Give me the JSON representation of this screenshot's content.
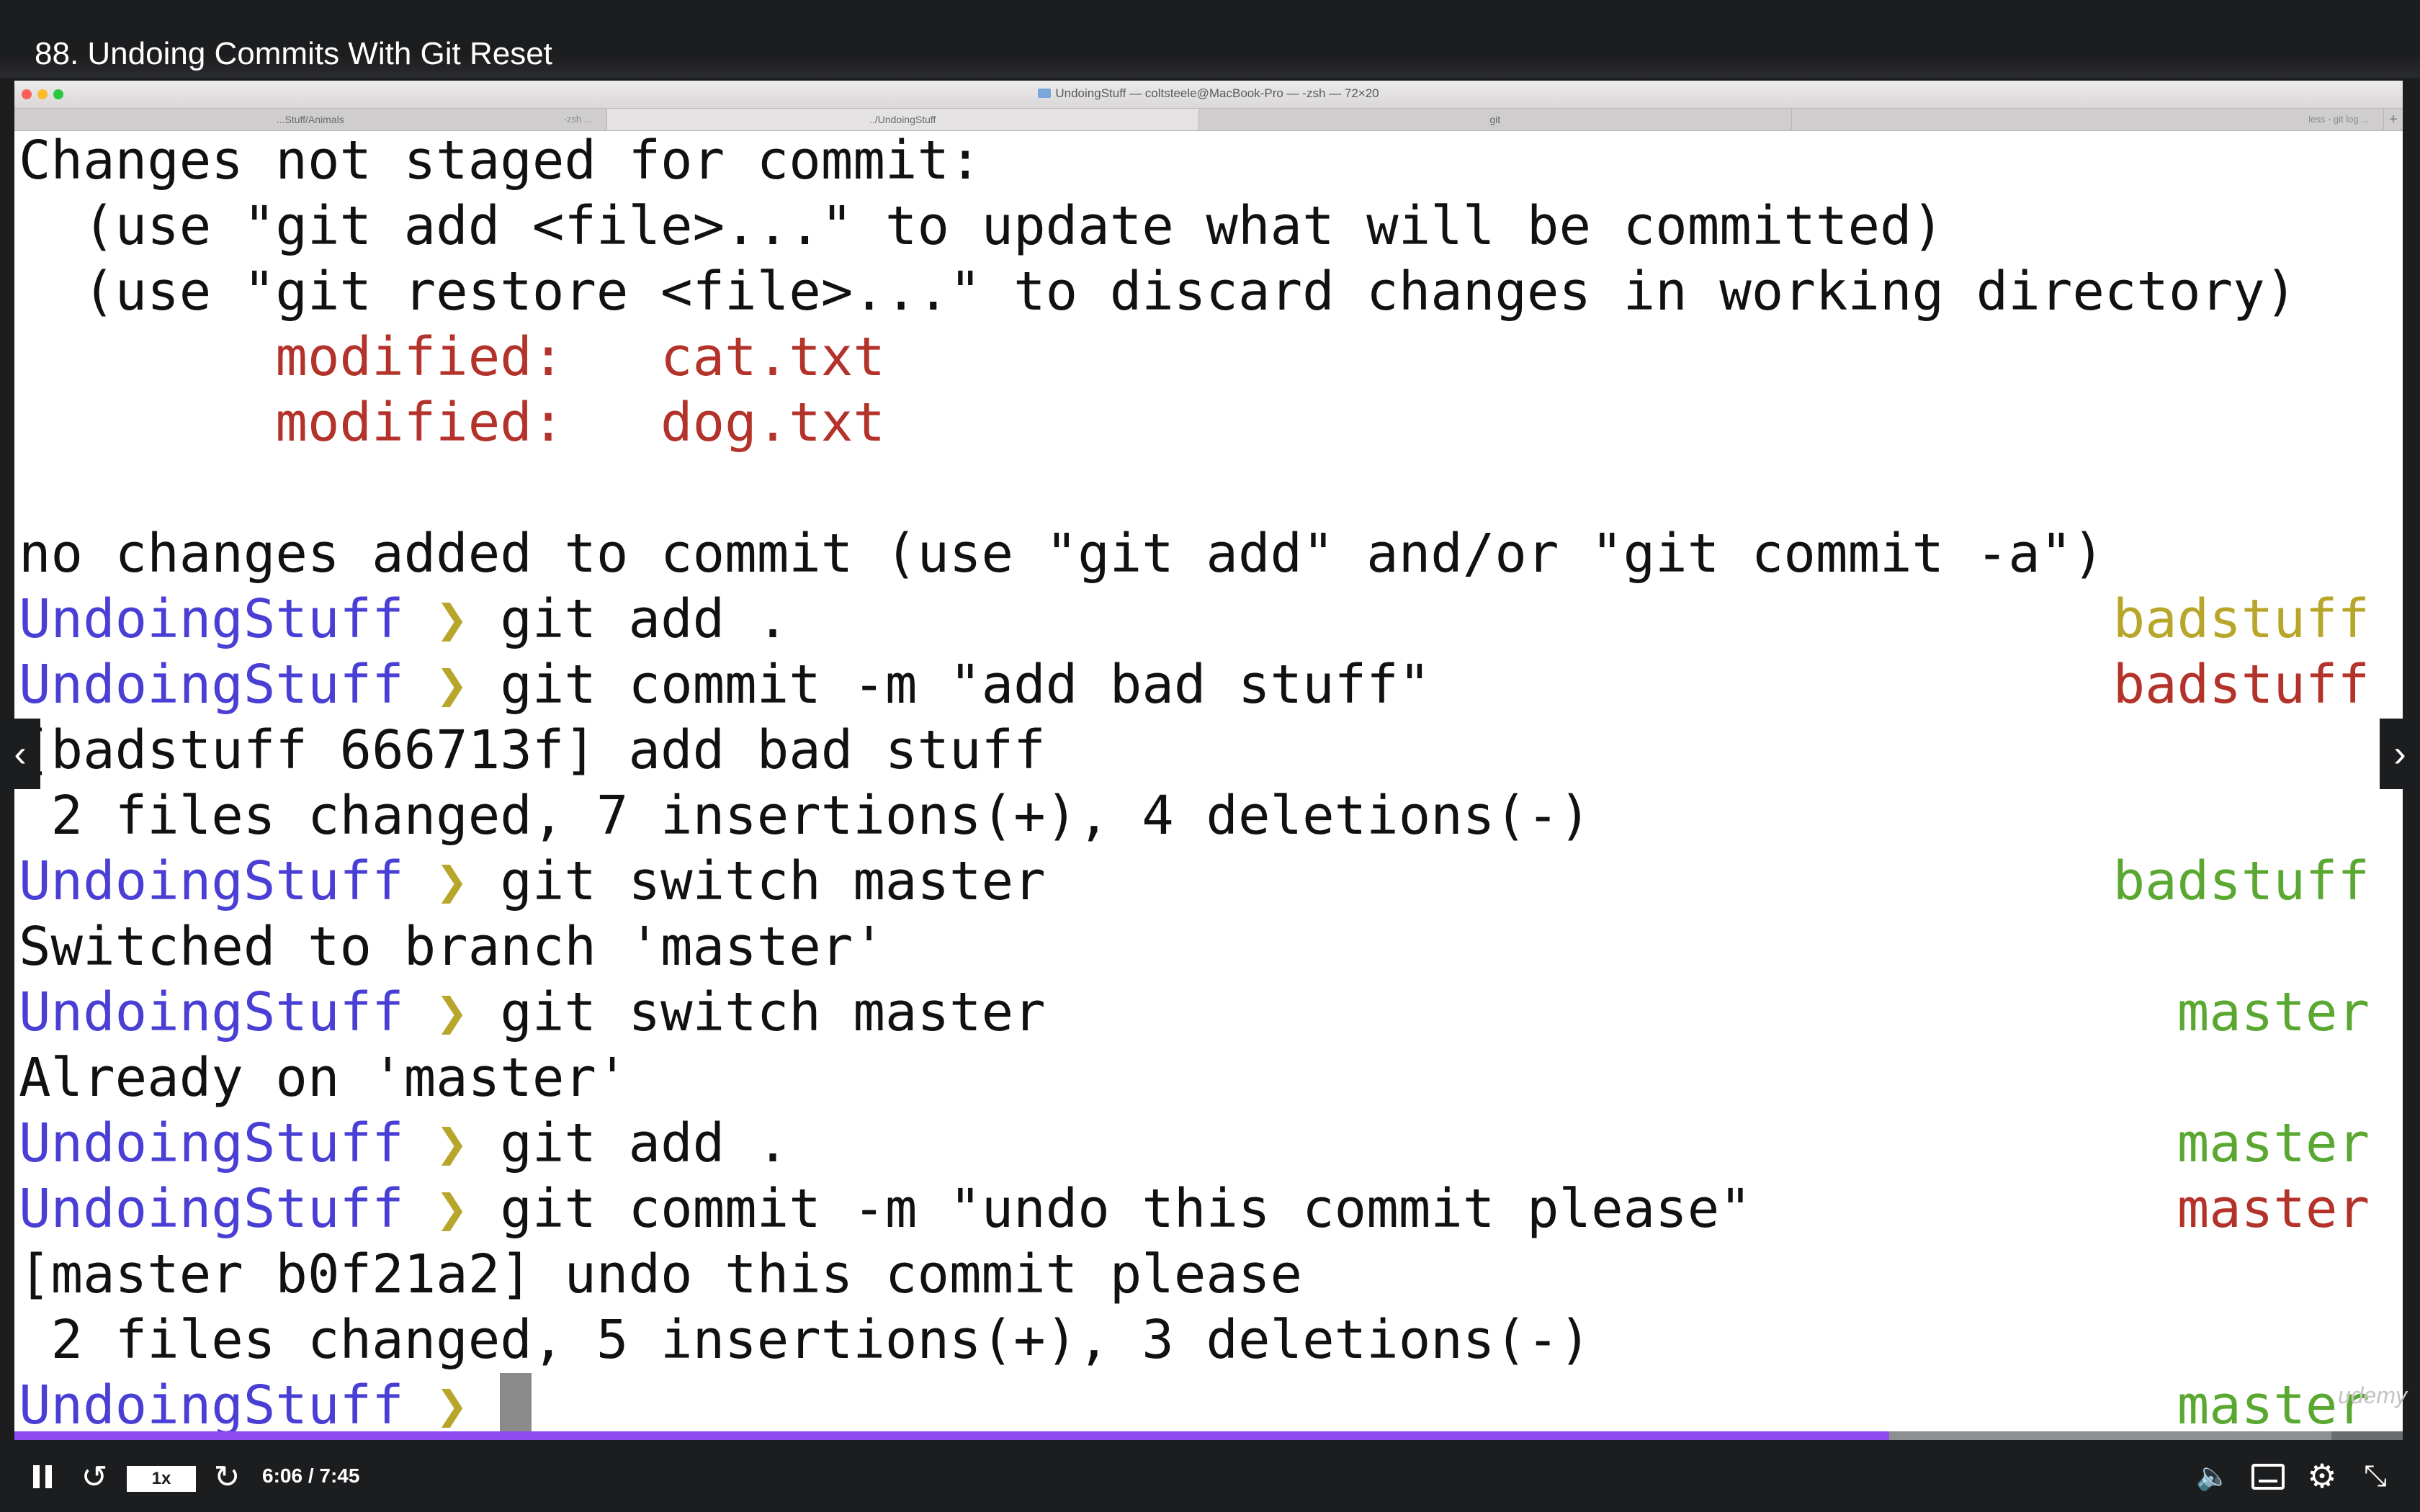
{
  "player": {
    "lecture_title": "88. Undoing Commits With Git Reset",
    "speed": "1x",
    "time": "6:06 / 7:45",
    "progress_fraction": 0.785,
    "buffered_fraction": 0.97,
    "watermark": "udemy"
  },
  "terminal_window": {
    "title": "UndoingStuff — coltsteele@MacBook-Pro — -zsh — 72×20",
    "tabs": [
      {
        "label": "...Stuff/Animals",
        "sub": "-zsh ..."
      },
      {
        "label": "../UndoingStuff",
        "sub": ""
      },
      {
        "label": "git",
        "sub": ""
      },
      {
        "label": "",
        "sub": "less - git log ..."
      }
    ],
    "add_tab": "+"
  },
  "terminal": {
    "prompt_dir": "UndoingStuff",
    "prompt_char": "❯",
    "lines": [
      {
        "text": "Changes not staged for commit:"
      },
      {
        "text": "  (use \"git add <file>...\" to update what will be committed)"
      },
      {
        "text": "  (use \"git restore <file>...\" to discard changes in working directory)"
      },
      {
        "text": "        modified:   cat.txt"
      },
      {
        "text": "        modified:   dog.txt"
      },
      {
        "text": ""
      },
      {
        "text": "no changes added to commit (use \"git add\" and/or \"git commit -a\")"
      },
      {
        "cmd": "git add .",
        "branch": "badstuff",
        "branch_color": "#b8a62a"
      },
      {
        "cmd": "git commit -m \"add bad stuff\"",
        "branch": "badstuff",
        "branch_color": "#b3322a"
      },
      {
        "text": "[badstuff 666713f] add bad stuff"
      },
      {
        "text": " 2 files changed, 7 insertions(+), 4 deletions(-)"
      },
      {
        "cmd": "git switch master",
        "branch": "badstuff",
        "branch_color": "#5aa832"
      },
      {
        "text": "Switched to branch 'master'"
      },
      {
        "cmd": "git switch master",
        "branch": "master",
        "branch_color": "#5aa832"
      },
      {
        "text": "Already on 'master'"
      },
      {
        "cmd": "git add .",
        "branch": "master",
        "branch_color": "#5aa832"
      },
      {
        "cmd": "git commit -m \"undo this commit please\"",
        "branch": "master",
        "branch_color": "#b3322a"
      },
      {
        "text": "[master b0f21a2] undo this commit please"
      },
      {
        "text": " 2 files changed, 5 insertions(+), 3 deletions(-)"
      },
      {
        "cmd": "",
        "branch": "master",
        "branch_color": "#5aa832"
      }
    ]
  },
  "colors": {
    "prompt_dir": "#4a3fd4",
    "prompt_char": "#b8a62a",
    "modified": "#b3322a",
    "progress": "#8d4bf0"
  },
  "icons": [
    "pause-icon",
    "rewind-icon",
    "forward-icon",
    "volume-icon",
    "captions-icon",
    "settings-icon",
    "fullscreen-exit-icon",
    "chevron-left-icon",
    "chevron-right-icon",
    "folder-icon"
  ]
}
